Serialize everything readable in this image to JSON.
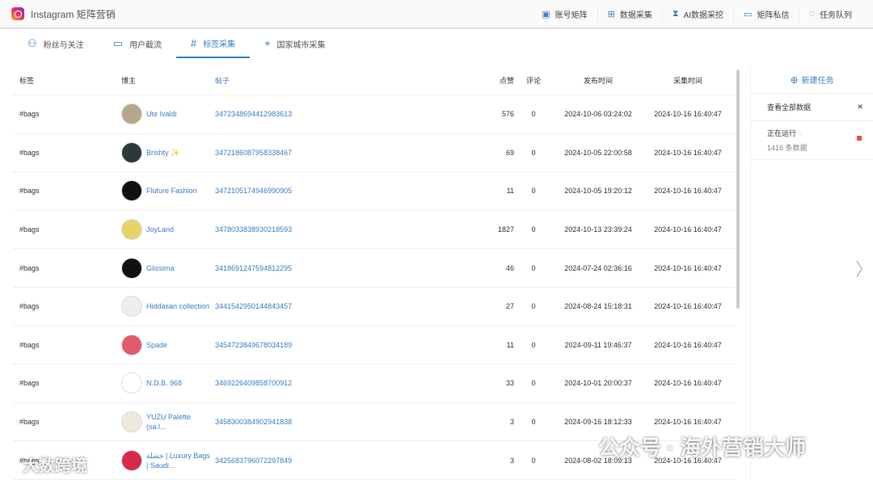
{
  "app": {
    "title": "Instagram 矩阵营销"
  },
  "nav": [
    {
      "icon": "account-icon",
      "label": "账号矩阵"
    },
    {
      "icon": "grid-icon",
      "label": "数据采集"
    },
    {
      "icon": "hourglass-icon",
      "label": "AI数据采挖"
    },
    {
      "icon": "message-icon",
      "label": "矩阵私信"
    },
    {
      "icon": "spinner-icon",
      "label": "任务队列"
    }
  ],
  "tabs": [
    {
      "icon": "users-icon",
      "label": "粉丝与关注"
    },
    {
      "icon": "message-icon",
      "label": "用户截流"
    },
    {
      "icon": "hash-icon",
      "label": "标签采集",
      "active": true
    },
    {
      "icon": "location-icon",
      "label": "国家城市采集"
    }
  ],
  "columns": [
    "标签",
    "博主",
    "帖子",
    "点赞",
    "评论",
    "发布时间",
    "采集时间"
  ],
  "rows": [
    {
      "tag": "#bags",
      "blogger": "Ute Ivaldi",
      "post": "3472348694412983613",
      "likes": "576",
      "comments": "0",
      "published": "2024-10-06 03:24:02",
      "collected": "2024-10-16 16:40:47",
      "avatar": "#b5a88a"
    },
    {
      "tag": "#bags",
      "blogger": "Brishty ✨",
      "post": "3472186087958338467",
      "likes": "69",
      "comments": "0",
      "published": "2024-10-05 22:00:58",
      "collected": "2024-10-16 16:40:47",
      "avatar": "#2a3a3a"
    },
    {
      "tag": "#bags",
      "blogger": "Fluture Fashion",
      "post": "3472105174946990905",
      "likes": "11",
      "comments": "0",
      "published": "2024-10-05 19:20:12",
      "collected": "2024-10-16 16:40:47",
      "avatar": "#111111"
    },
    {
      "tag": "#bags",
      "blogger": "JoyLand",
      "post": "3478033838930218593",
      "likes": "1827",
      "comments": "0",
      "published": "2024-10-13 23:39:24",
      "collected": "2024-10-16 16:40:47",
      "avatar": "#e8d36a"
    },
    {
      "tag": "#bags",
      "blogger": "Glissima",
      "post": "3418691247594812295",
      "likes": "46",
      "comments": "0",
      "published": "2024-07-24 02:36:16",
      "collected": "2024-10-16 16:40:47",
      "avatar": "#111111"
    },
    {
      "tag": "#bags",
      "blogger": "Hiddasan collection",
      "post": "3441542950144843457",
      "likes": "27",
      "comments": "0",
      "published": "2024-08-24 15:18:31",
      "collected": "2024-10-16 16:40:47",
      "avatar": "#eeeeee"
    },
    {
      "tag": "#bags",
      "blogger": "Spade",
      "post": "3454723849678034189",
      "likes": "11",
      "comments": "0",
      "published": "2024-09-11 19:46:37",
      "collected": "2024-10-16 16:40:47",
      "avatar": "#e05a6a"
    },
    {
      "tag": "#bags",
      "blogger": "N.D.B. 968",
      "post": "3469226409858700912",
      "likes": "33",
      "comments": "0",
      "published": "2024-10-01 20:00:37",
      "collected": "2024-10-16 16:40:47",
      "avatar": "#ffffff"
    },
    {
      "tag": "#bags",
      "blogger": "YUZU Palette (sa.l...",
      "post": "3458300384902941838",
      "likes": "3",
      "comments": "0",
      "published": "2024-09-16 18:12:33",
      "collected": "2024-10-16 16:40:47",
      "avatar": "#efe8dc"
    },
    {
      "tag": "#bags",
      "blogger": "خشلة | Luxury Bags | Saudi...",
      "post": "3425683796072297849",
      "likes": "3",
      "comments": "0",
      "published": "2024-08-02 18:09:13",
      "collected": "2024-10-16 16:40:47",
      "avatar": "#d92a4a"
    }
  ],
  "side": {
    "new_task": "新建任务",
    "view_all": "查看全部数据",
    "running": "正在运行",
    "count": "1416 条数据"
  },
  "watermarks": [
    "公众号 · 海外营销大师",
    "大数跨境"
  ]
}
